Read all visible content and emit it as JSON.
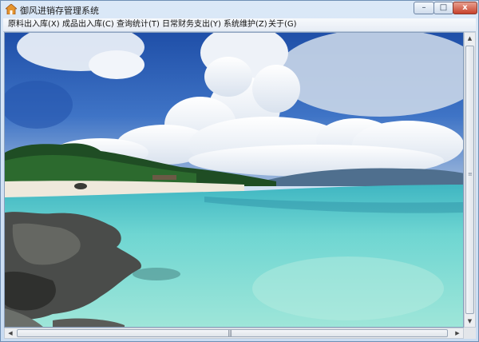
{
  "window": {
    "title": "御风进销存管理系统",
    "icon": "house-icon",
    "controls": {
      "minimize": "–",
      "maximize": "□",
      "close": "x"
    }
  },
  "menu": [
    {
      "label": "原料出入库(X)"
    },
    {
      "label": "成品出入库(C)"
    },
    {
      "label": "查询统计(T)"
    },
    {
      "label": "日常财务支出(Y)"
    },
    {
      "label": "系统维护(Z)"
    },
    {
      "label": "关于(G)"
    }
  ],
  "background_image": {
    "subject": "tropical beach with turquoise water, white clouds and rocks"
  },
  "scrollbars": {
    "vertical": {
      "up": "▲",
      "down": "▼",
      "grip": "≡"
    },
    "horizontal": {
      "left": "◀",
      "right": "▶",
      "grip": "|||"
    }
  },
  "colors": {
    "sky": "#2f5fb4",
    "sea": "#5fd0cf",
    "sand": "#efe9dc",
    "close_button": "#c7412b"
  }
}
